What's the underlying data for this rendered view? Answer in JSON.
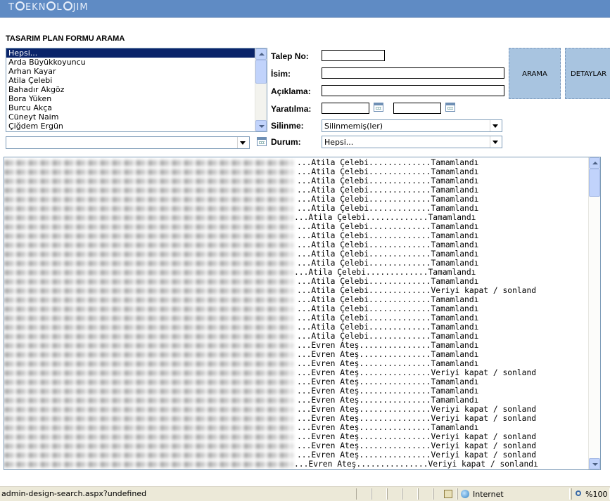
{
  "app": {
    "logo": "TEKNOLOJIM",
    "form_title": "TASARIM PLAN FORMU ARAMA"
  },
  "user_list": {
    "items": [
      "Hepsi...",
      "Arda Büyükkoyuncu",
      "Arhan Kayar",
      "Atila Çelebi",
      "Bahadır Akgöz",
      "Bora Yüken",
      "Burcu Akça",
      "Cüneyt Naim",
      "Çiğdem Ergün"
    ],
    "selected_index": 0
  },
  "user_dropdown": {
    "value": ""
  },
  "fields": {
    "talep_no": {
      "label": "Talep No:",
      "value": ""
    },
    "isim": {
      "label": "İsim:",
      "value": ""
    },
    "aciklama": {
      "label": "Açıklama:",
      "value": ""
    },
    "yaratilma": {
      "label": "Yaratılma:",
      "from": "",
      "to": ""
    },
    "silinme": {
      "label": "Silinme:",
      "value": "Silinmemiş(ler)"
    },
    "durum": {
      "label": "Durum:",
      "value": "Hepsi..."
    }
  },
  "buttons": {
    "search": "ARAMA",
    "details": "DETAYLAR"
  },
  "results": {
    "rows": [
      {
        "name": "Atila Çelebi",
        "status": "Tamamlandı",
        "pad": 4
      },
      {
        "name": "Atila Çelebi",
        "status": "Tamamlandı",
        "pad": 4
      },
      {
        "name": "Atila Çelebi",
        "status": "Tamamlandı",
        "pad": 4
      },
      {
        "name": "Atila Çelebi",
        "status": "Tamamlandı",
        "pad": 4
      },
      {
        "name": "Atila Çelebi",
        "status": "Tamamlandı",
        "pad": 4
      },
      {
        "name": "Atila Çelebi",
        "status": "Tamamlandı",
        "pad": 4
      },
      {
        "name": "Atila Çelebi",
        "status": "Tamamlandı",
        "pad": 0
      },
      {
        "name": "Atila Çelebi",
        "status": "Tamamlandı",
        "pad": 4
      },
      {
        "name": "Atila Çelebi",
        "status": "Tamamlandı",
        "pad": 4
      },
      {
        "name": "Atila Çelebi",
        "status": "Tamamlandı",
        "pad": 4
      },
      {
        "name": "Atila Çelebi",
        "status": "Tamamlandı",
        "pad": 4
      },
      {
        "name": "Atila Çelebi",
        "status": "Tamamlandı",
        "pad": 4
      },
      {
        "name": "Atila Çelebi",
        "status": "Tamamlandı",
        "pad": 0
      },
      {
        "name": "Atila Çelebi",
        "status": "Tamamlandı",
        "pad": 4
      },
      {
        "name": "Atila Çelebi",
        "status": "Veriyi kapat / sonland",
        "pad": 4
      },
      {
        "name": "Atila Çelebi",
        "status": "Tamamlandı",
        "pad": 4
      },
      {
        "name": "Atila Çelebi",
        "status": "Tamamlandı",
        "pad": 4
      },
      {
        "name": "Atila Çelebi",
        "status": "Tamamlandı",
        "pad": 4
      },
      {
        "name": "Atila Çelebi",
        "status": "Tamamlandı",
        "pad": 4
      },
      {
        "name": "Atila Çelebi",
        "status": "Tamamlandı",
        "pad": 4
      },
      {
        "name": "Evren Ateş",
        "status": "Tamamlandı",
        "pad": 4
      },
      {
        "name": "Evren Ateş",
        "status": "Tamamlandı",
        "pad": 4
      },
      {
        "name": "Evren Ateş",
        "status": "Tamamlandı",
        "pad": 4
      },
      {
        "name": "Evren Ateş",
        "status": "Veriyi kapat / sonland",
        "pad": 4
      },
      {
        "name": "Evren Ateş",
        "status": "Tamamlandı",
        "pad": 4
      },
      {
        "name": "Evren Ateş",
        "status": "Tamamlandı",
        "pad": 4
      },
      {
        "name": "Evren Ateş",
        "status": "Tamamlandı",
        "pad": 4
      },
      {
        "name": "Evren Ateş",
        "status": "Veriyi kapat / sonland",
        "pad": 4
      },
      {
        "name": "Evren Ateş",
        "status": "Veriyi kapat / sonland",
        "pad": 4
      },
      {
        "name": "Evren Ateş",
        "status": "Tamamlandı",
        "pad": 4
      },
      {
        "name": "Evren Ateş",
        "status": "Veriyi kapat / sonland",
        "pad": 4
      },
      {
        "name": "Evren Ateş",
        "status": "Veriyi kapat / sonland",
        "pad": 4
      },
      {
        "name": "Evren Ateş",
        "status": "Veriyi kapat / sonland",
        "pad": 4
      },
      {
        "name": "Evren Ateş",
        "status": "Veriyi kapat / sonlandı",
        "pad": 0
      }
    ]
  },
  "statusbar": {
    "url": "admin-design-search.aspx?undefined",
    "zone": "Internet",
    "zoom": "%100"
  },
  "colors": {
    "header": "#5f8bc4",
    "selection": "#0a246a",
    "button_bg": "#a8c4e0"
  }
}
